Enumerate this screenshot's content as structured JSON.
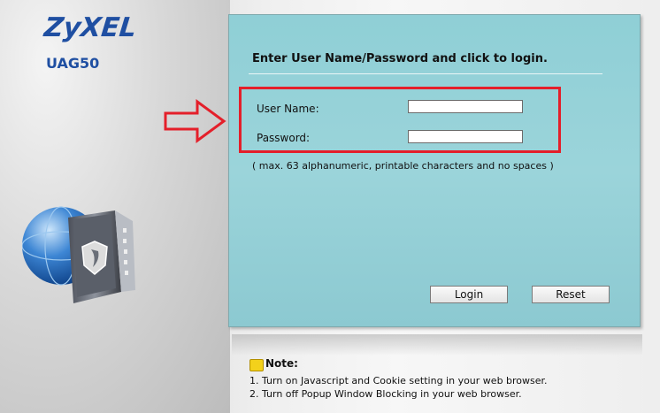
{
  "brand": {
    "name": "ZyXEL",
    "model": "UAG50",
    "color": "#1f4fa2"
  },
  "login": {
    "title": "Enter User Name/Password and click to login.",
    "username_label": "User Name:",
    "username_value": "",
    "password_label": "Password:",
    "password_value": "",
    "hint": "( max. 63 alphanumeric, printable characters and no spaces )",
    "login_button": "Login",
    "reset_button": "Reset",
    "panel_color": "#9bd4da"
  },
  "annotation": {
    "highlight_color": "#e41f2a",
    "arrow_icon": "right-arrow-icon"
  },
  "note": {
    "title": "Note:",
    "icon": "note-icon",
    "items": [
      "1. Turn on Javascript and Cookie setting in your web browser.",
      "2. Turn off Popup Window Blocking in your web browser."
    ]
  }
}
